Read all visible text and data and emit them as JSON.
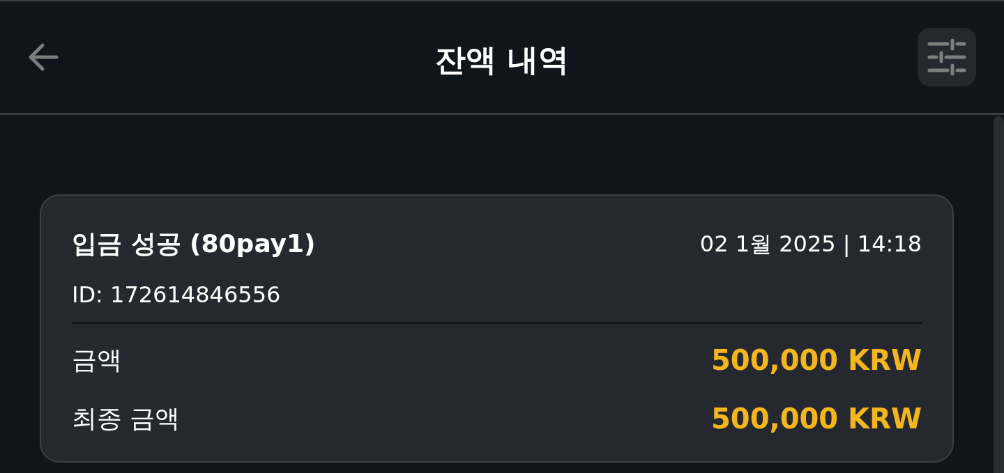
{
  "header": {
    "title": "잔액 내역"
  },
  "transactions": [
    {
      "title": "입금 성공 (80pay1)",
      "datetime": "02 1월 2025 | 14:18",
      "id": "ID: 172614846556",
      "rows": [
        {
          "label": "금액",
          "value": "500,000 KRW"
        },
        {
          "label": "최종 금액",
          "value": "500,000 KRW"
        }
      ]
    }
  ]
}
